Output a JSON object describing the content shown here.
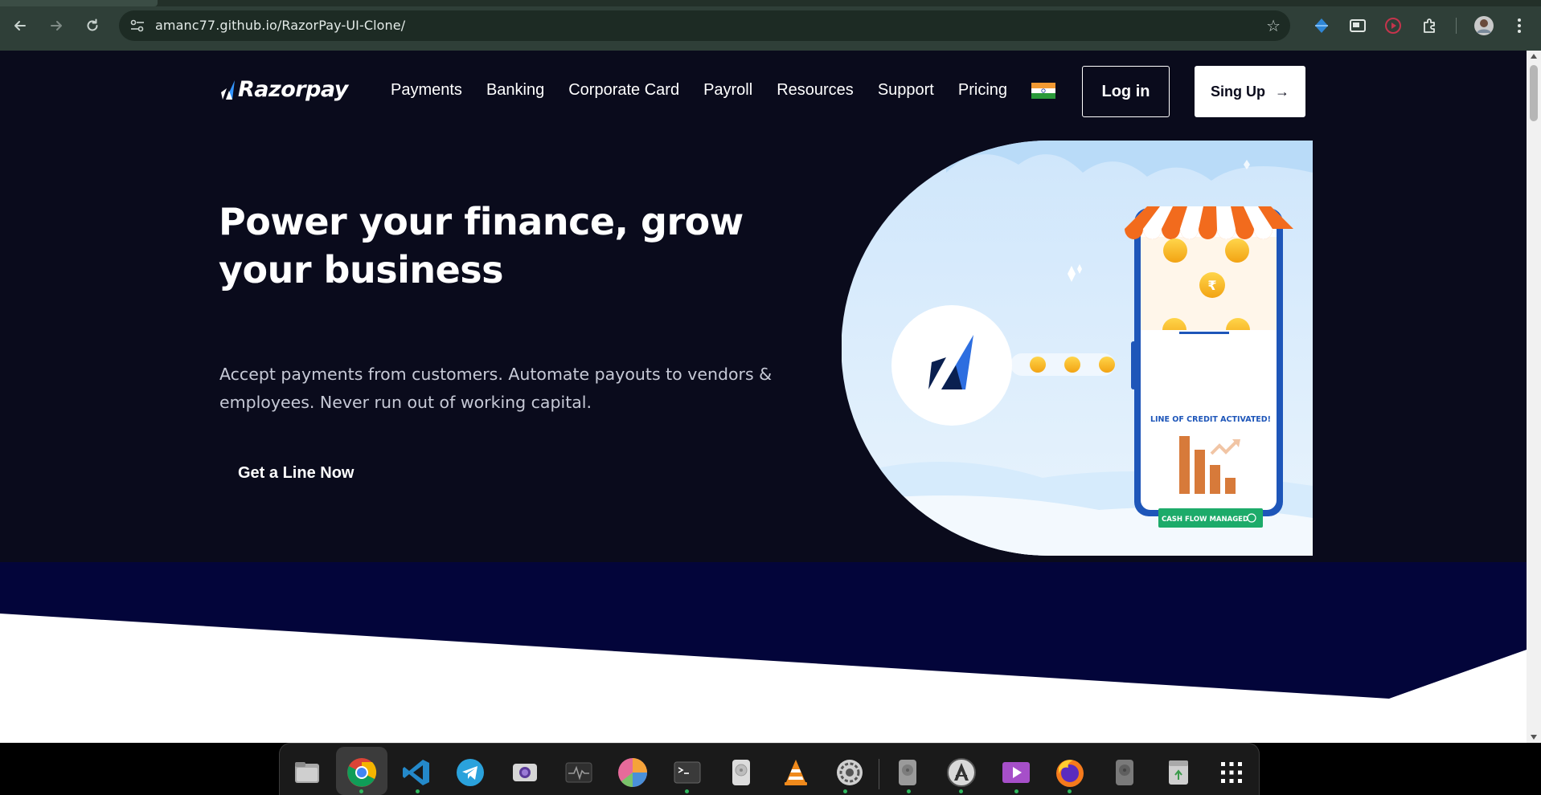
{
  "browser": {
    "url": "amanc77.github.io/RazorPay-UI-Clone/",
    "back_icon": "arrow-left-icon",
    "forward_icon": "arrow-right-icon",
    "reload_icon": "reload-icon",
    "bookmark_icon": "star-icon",
    "extensions": [
      "extension-diamond-icon",
      "picture-in-picture-icon",
      "record-icon",
      "puzzle-icon",
      "profile-avatar",
      "kebab-menu-icon"
    ]
  },
  "header": {
    "logo_text": "Razorpay",
    "nav": [
      "Payments",
      "Banking",
      "Corporate Card",
      "Payroll",
      "Resources",
      "Support",
      "Pricing"
    ],
    "login_label": "Log in",
    "signup_label": "Sing Up",
    "signup_arrow": "→"
  },
  "hero": {
    "title": "Power your finance, grow your business",
    "subtitle": "Accept payments from customers. Automate payouts to vendors & employees. Never run out of working capital.",
    "cta_label": "Get a Line Now"
  },
  "illustration": {
    "phone_banner": "LINE OF CREDIT ACTIVATED!",
    "phone_badge": "CASH FLOW MANAGED",
    "coin_symbol": "₹"
  },
  "colors": {
    "hero_bg": "#0a0b1c",
    "band_bg": "#03053a",
    "accent_blue": "#3395ff",
    "awning_orange": "#f26b1d",
    "badge_green": "#1dab6a"
  },
  "dock": {
    "apps": [
      "files-icon",
      "chrome-icon",
      "vscode-icon",
      "telegram-icon",
      "screenshot-icon",
      "system-monitor-icon",
      "disk-usage-icon",
      "terminal-icon",
      "disks-icon",
      "vlc-icon",
      "settings-icon",
      "drive-icon",
      "software-updater-icon",
      "media-player-icon",
      "firefox-icon",
      "drive-2-icon",
      "trash-icon",
      "app-grid-icon"
    ]
  }
}
